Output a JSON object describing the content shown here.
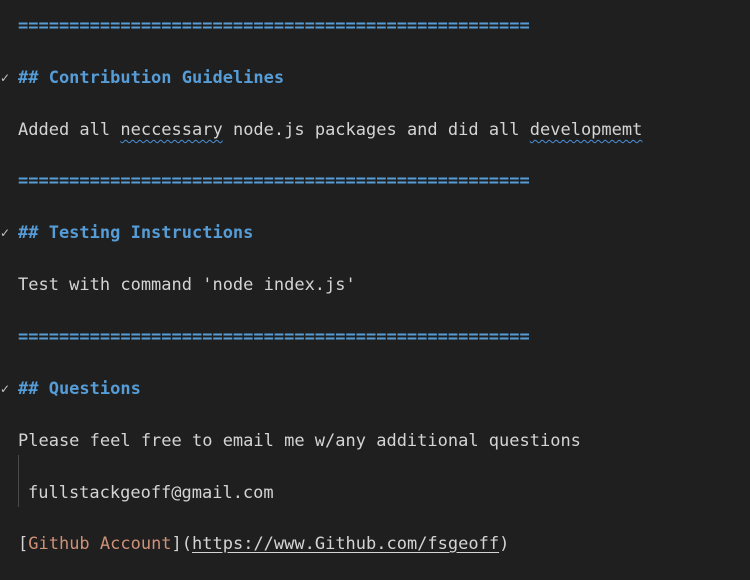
{
  "rule_line": "==================================================",
  "sections": [
    {
      "heading": "## Contribution Guidelines",
      "body_parts": [
        "Added all ",
        "neccessary",
        " node.js packages and did all ",
        "developmemt"
      ]
    },
    {
      "heading": "## Testing Instructions",
      "body": "Test with command 'node index.js'"
    },
    {
      "heading": "## Questions",
      "body": "Please feel free to email me w/any additional questions"
    }
  ],
  "email": "fullstackgeoff@gmail.com",
  "link": {
    "open_bracket": "[",
    "text": "Github Account",
    "middle": "](",
    "url": "https://www.Github.com/fsgeoff",
    "close": ")"
  },
  "fold_glyph": "✓"
}
